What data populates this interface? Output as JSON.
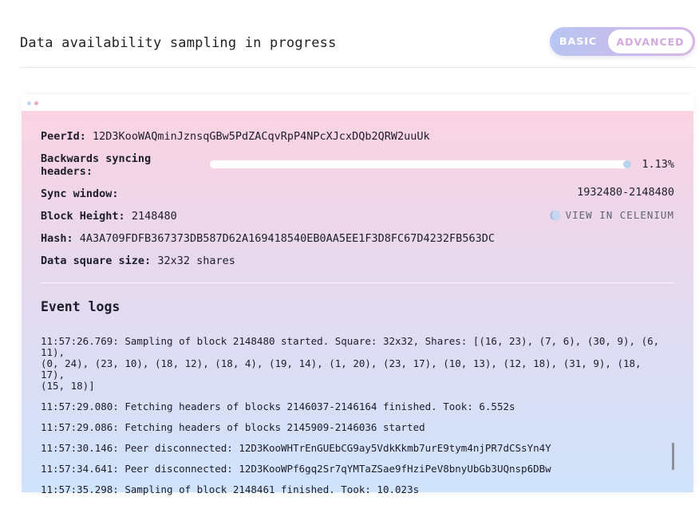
{
  "header": {
    "title": "Data availability sampling in progress",
    "toggle": {
      "basic_label": "BASIC",
      "advanced_label": "ADVANCED",
      "selected": "ADVANCED"
    }
  },
  "node": {
    "peer_id_label": "PeerId:",
    "peer_id": "12D3KooWAQminJznsqGBw5PdZACqvRpP4NPcXJcxDQb2QRW2uuUk",
    "backwards_label_line1": "Backwards syncing",
    "backwards_label_line2": "headers:",
    "backwards_progress_percent": 1.13,
    "backwards_percent_text": "1.13%",
    "sync_window_label": "Sync window:",
    "sync_window": "1932480-2148480",
    "block_height_label": "Block Height:",
    "block_height": "2148480",
    "celenium_link": "VIEW IN CELENIUM",
    "hash_label": "Hash:",
    "hash": "4A3A709FDFB367373DB587D62A169418540EB0AA5EE1F3D8FC67D4232FB563DC",
    "square_label": "Data square size:",
    "square_size": "32x32 shares"
  },
  "event_logs": {
    "title": "Event logs",
    "entries": [
      "11:57:26.769: Sampling of block 2148480 started. Square: 32x32, Shares: [(16, 23), (7, 6), (30, 9), (6, 11),\n(0, 24), (23, 10), (18, 12), (18, 4), (19, 14), (1, 20), (23, 17), (10, 13), (12, 18), (31, 9), (18, 17),\n(15, 18)]",
      "11:57:29.080: Fetching headers of blocks 2146037-2146164 finished. Took: 6.552s",
      "11:57:29.086: Fetching headers of blocks 2145909-2146036 started",
      "11:57:30.146: Peer disconnected: 12D3KooWHTrEnGUEbCG9ay5VdkKkmb7urE9tym4njPR7dCSsYn4Y",
      "11:57:34.641: Peer disconnected: 12D3KooWPf6gq2Sr7qYMTaZSae9fHziPeV8bnyUbGb3UQnsp6DBw",
      "11:57:35.298: Sampling of block 2148461 finished. Took: 10.023s"
    ]
  },
  "colors": {
    "panel_top": "#fbd3e2",
    "panel_bottom": "#cfe3fb",
    "toggle_left": "#b7c6f2",
    "toggle_right": "#d8b4e6",
    "advanced_text": "#d3a9dd"
  },
  "icons": {
    "celenium": "moon-icon"
  }
}
